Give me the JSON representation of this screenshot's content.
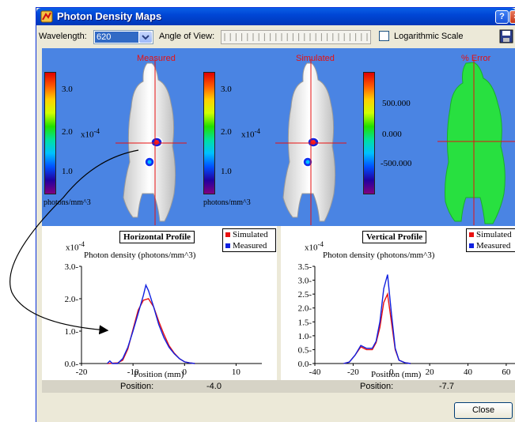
{
  "window": {
    "title": "Photon Density Maps",
    "help_label": "?",
    "close_label": "×"
  },
  "toolbar": {
    "wavelength_label": "Wavelength:",
    "wavelength_value": "620",
    "angle_label": "Angle of View:",
    "log_scale_label": "Logarithmic Scale",
    "log_scale_checked": false
  },
  "panels": [
    {
      "label": "Measured"
    },
    {
      "label": "Simulated"
    },
    {
      "label": "% Error"
    }
  ],
  "colorbars": [
    {
      "ticks": [
        "3.0",
        "2.0",
        "1.0"
      ],
      "exponent": "x10",
      "exponent_power": "-4",
      "unit": "photons/mm^3"
    },
    {
      "ticks": [
        "3.0",
        "2.0",
        "1.0"
      ],
      "exponent": "x10",
      "exponent_power": "-4",
      "unit": "photons/mm^3"
    },
    {
      "ticks": [
        "500.000",
        "0.000",
        "-500.000"
      ]
    }
  ],
  "plots": {
    "horizontal": {
      "title": "Horizontal Profile",
      "legend": [
        "Simulated",
        "Measured"
      ],
      "ylabel": "Photon density (photons/mm^3)",
      "xlabel": "Position (mm)",
      "exponent": "x10",
      "exponent_power": "-4",
      "position_label": "Position:",
      "position_value": "-4.0"
    },
    "vertical": {
      "title": "Vertical Profile",
      "legend": [
        "Simulated",
        "Measured"
      ],
      "ylabel": "Photon density (photons/mm^3)",
      "xlabel": "Position (mm)",
      "exponent": "x10",
      "exponent_power": "-4",
      "position_label": "Position:",
      "position_value": "-7.7"
    }
  },
  "buttons": {
    "close": "Close"
  },
  "colors": {
    "simulated": "#e81010",
    "measured": "#1020e0",
    "crosshair": "#e81010",
    "panel_bg": "#4a84e3"
  },
  "chart_data": [
    {
      "type": "line",
      "title": "Horizontal Profile",
      "xlabel": "Position (mm)",
      "ylabel": "Photon density (photons/mm^3)",
      "xlim": [
        -20,
        15
      ],
      "ylim": [
        0,
        3.0
      ],
      "xticks": [
        -20,
        -10,
        0,
        10
      ],
      "yticks": [
        0.0,
        1.0,
        2.0,
        3.0
      ],
      "series": [
        {
          "name": "Simulated",
          "x": [
            -15,
            -13,
            -12,
            -11,
            -10,
            -9,
            -8,
            -7,
            -6,
            -5,
            -4,
            -3,
            -2,
            -1,
            0,
            1,
            2
          ],
          "y": [
            0,
            0.02,
            0.1,
            0.45,
            1.05,
            1.65,
            1.95,
            2.0,
            1.75,
            1.3,
            0.9,
            0.55,
            0.32,
            0.15,
            0.05,
            0.02,
            0
          ]
        },
        {
          "name": "Measured",
          "x": [
            -15,
            -14.5,
            -14,
            -13,
            -12,
            -11,
            -10,
            -9,
            -8,
            -7.5,
            -7,
            -6,
            -5,
            -4,
            -3,
            -2,
            -1,
            0,
            1,
            2
          ],
          "y": [
            0,
            0.08,
            0,
            0,
            0.15,
            0.5,
            1.0,
            1.55,
            2.1,
            2.42,
            2.25,
            1.75,
            1.2,
            0.8,
            0.5,
            0.3,
            0.15,
            0.05,
            0.02,
            0
          ]
        }
      ]
    },
    {
      "type": "line",
      "title": "Vertical Profile",
      "xlabel": "Position (mm)",
      "ylabel": "Photon density (photons/mm^3)",
      "xlim": [
        -40,
        65
      ],
      "ylim": [
        0,
        3.5
      ],
      "xticks": [
        -40,
        -20,
        0,
        20,
        40,
        60
      ],
      "yticks": [
        0.0,
        0.5,
        1.0,
        1.5,
        2.0,
        2.5,
        3.0,
        3.5
      ],
      "series": [
        {
          "name": "Simulated",
          "x": [
            -25,
            -22,
            -19,
            -16,
            -13,
            -10,
            -8,
            -6,
            -4,
            -2,
            0,
            2,
            4,
            7,
            10
          ],
          "y": [
            0,
            0.05,
            0.3,
            0.6,
            0.5,
            0.5,
            0.75,
            1.3,
            2.2,
            2.5,
            1.5,
            0.5,
            0.12,
            0.03,
            0
          ]
        },
        {
          "name": "Measured",
          "x": [
            -25,
            -22,
            -19,
            -16,
            -13,
            -10,
            -8,
            -6,
            -4,
            -2,
            0,
            2,
            4,
            7,
            10
          ],
          "y": [
            0,
            0.05,
            0.3,
            0.65,
            0.55,
            0.55,
            0.8,
            1.5,
            2.7,
            3.2,
            1.8,
            0.55,
            0.12,
            0.03,
            0
          ]
        }
      ]
    }
  ]
}
